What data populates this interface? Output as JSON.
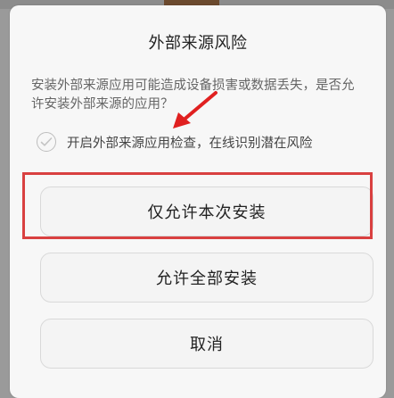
{
  "dialog": {
    "title": "外部来源风险",
    "message": "安装外部来源应用可能造成设备损害或数据丢失，是否允许安装外部来源的应用？",
    "checkbox_label": "开启外部来源应用检查，在线识别潜在风险",
    "checkbox_checked": false,
    "buttons": {
      "allow_once": "仅允许本次安装",
      "allow_all": "允许全部安装",
      "cancel": "取消"
    }
  },
  "annotation": {
    "highlight_color": "#d94040",
    "arrow_color": "#e02020"
  }
}
